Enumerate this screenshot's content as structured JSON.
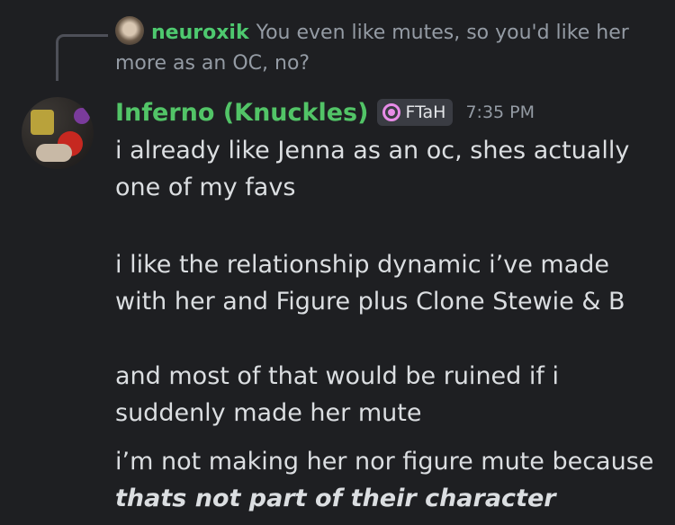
{
  "reply": {
    "author": "neuroxik",
    "text": "You even like mutes, so you'd like her more as an OC, no?"
  },
  "message": {
    "author": "Inferno (Knuckles)",
    "tag": "FTaH",
    "timestamp": "7:35 PM",
    "paragraphs": [
      "i already like Jenna as an oc, shes actually one of my favs",
      "i like the relationship dynamic i’ve made with her and Figure plus Clone Stewie & B",
      "and most of that would be ruined if i suddenly made her mute"
    ],
    "followup": {
      "text": "i’m not making her nor figure mute because",
      "emphasis": "thats not part of their character"
    }
  },
  "colors": {
    "background": "#1e1f22",
    "author": "#52c467",
    "reply_author": "#4ec96f",
    "muted": "#949ba4",
    "text": "#dbdee1",
    "tag_icon": "#e88ce8"
  }
}
